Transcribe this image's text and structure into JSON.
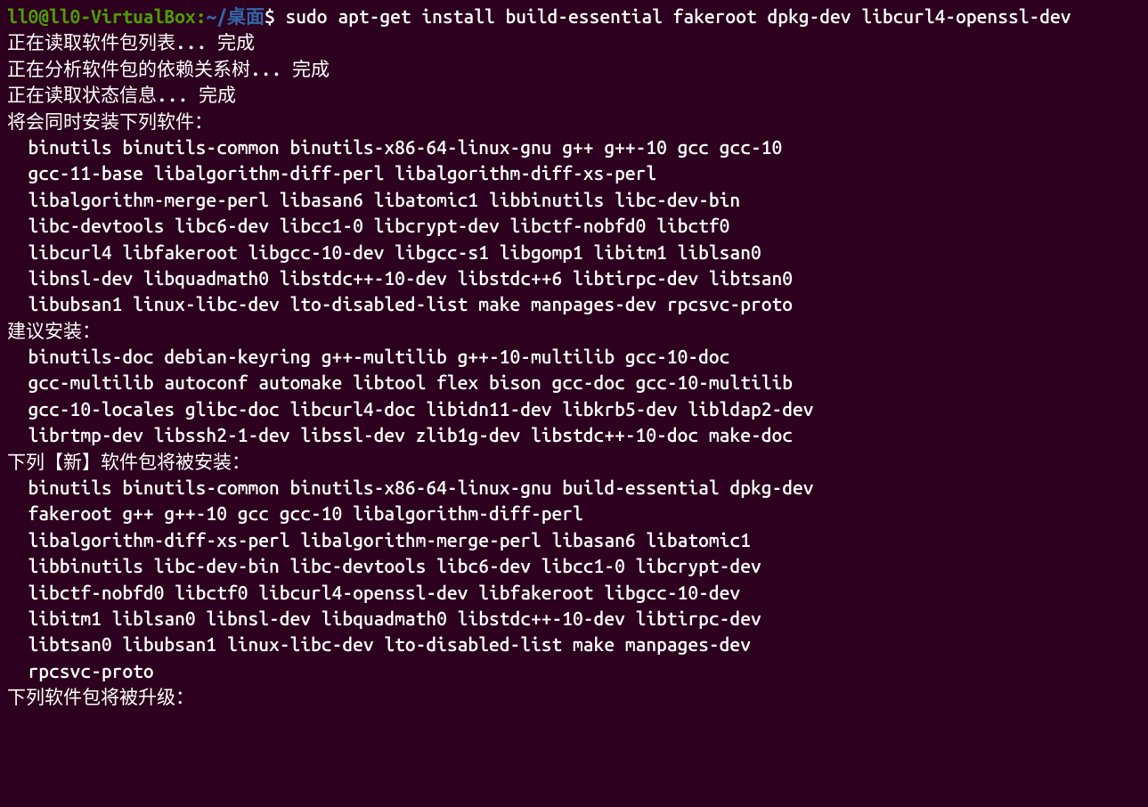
{
  "prompt": {
    "user_host": "ll0@ll0-VirtualBox",
    "colon": ":",
    "path": "~/桌面",
    "dollar": "$ "
  },
  "command": "sudo apt-get install build-essential fakeroot dpkg-dev libcurl4-openssl-dev",
  "output": {
    "line1": "正在读取软件包列表... 完成",
    "line2": "正在分析软件包的依赖关系树... 完成",
    "line3": "正在读取状态信息... 完成",
    "line4": "将会同时安装下列软件：",
    "additional_packages": [
      "binutils binutils-common binutils-x86-64-linux-gnu g++ g++-10 gcc gcc-10",
      "gcc-11-base libalgorithm-diff-perl libalgorithm-diff-xs-perl",
      "libalgorithm-merge-perl libasan6 libatomic1 libbinutils libc-dev-bin",
      "libc-devtools libc6-dev libcc1-0 libcrypt-dev libctf-nobfd0 libctf0",
      "libcurl4 libfakeroot libgcc-10-dev libgcc-s1 libgomp1 libitm1 liblsan0",
      "libnsl-dev libquadmath0 libstdc++-10-dev libstdc++6 libtirpc-dev libtsan0",
      "libubsan1 linux-libc-dev lto-disabled-list make manpages-dev rpcsvc-proto"
    ],
    "line5": "建议安装：",
    "suggested_packages": [
      "binutils-doc debian-keyring g++-multilib g++-10-multilib gcc-10-doc",
      "gcc-multilib autoconf automake libtool flex bison gcc-doc gcc-10-multilib",
      "gcc-10-locales glibc-doc libcurl4-doc libidn11-dev libkrb5-dev libldap2-dev",
      "librtmp-dev libssh2-1-dev libssl-dev zlib1g-dev libstdc++-10-doc make-doc"
    ],
    "line6": "下列【新】软件包将被安装：",
    "new_packages": [
      "binutils binutils-common binutils-x86-64-linux-gnu build-essential dpkg-dev",
      "fakeroot g++ g++-10 gcc gcc-10 libalgorithm-diff-perl",
      "libalgorithm-diff-xs-perl libalgorithm-merge-perl libasan6 libatomic1",
      "libbinutils libc-dev-bin libc-devtools libc6-dev libcc1-0 libcrypt-dev",
      "libctf-nobfd0 libctf0 libcurl4-openssl-dev libfakeroot libgcc-10-dev",
      "libitm1 liblsan0 libnsl-dev libquadmath0 libstdc++-10-dev libtirpc-dev",
      "libtsan0 libubsan1 linux-libc-dev lto-disabled-list make manpages-dev",
      "rpcsvc-proto"
    ],
    "line7": "下列软件包将被升级："
  }
}
